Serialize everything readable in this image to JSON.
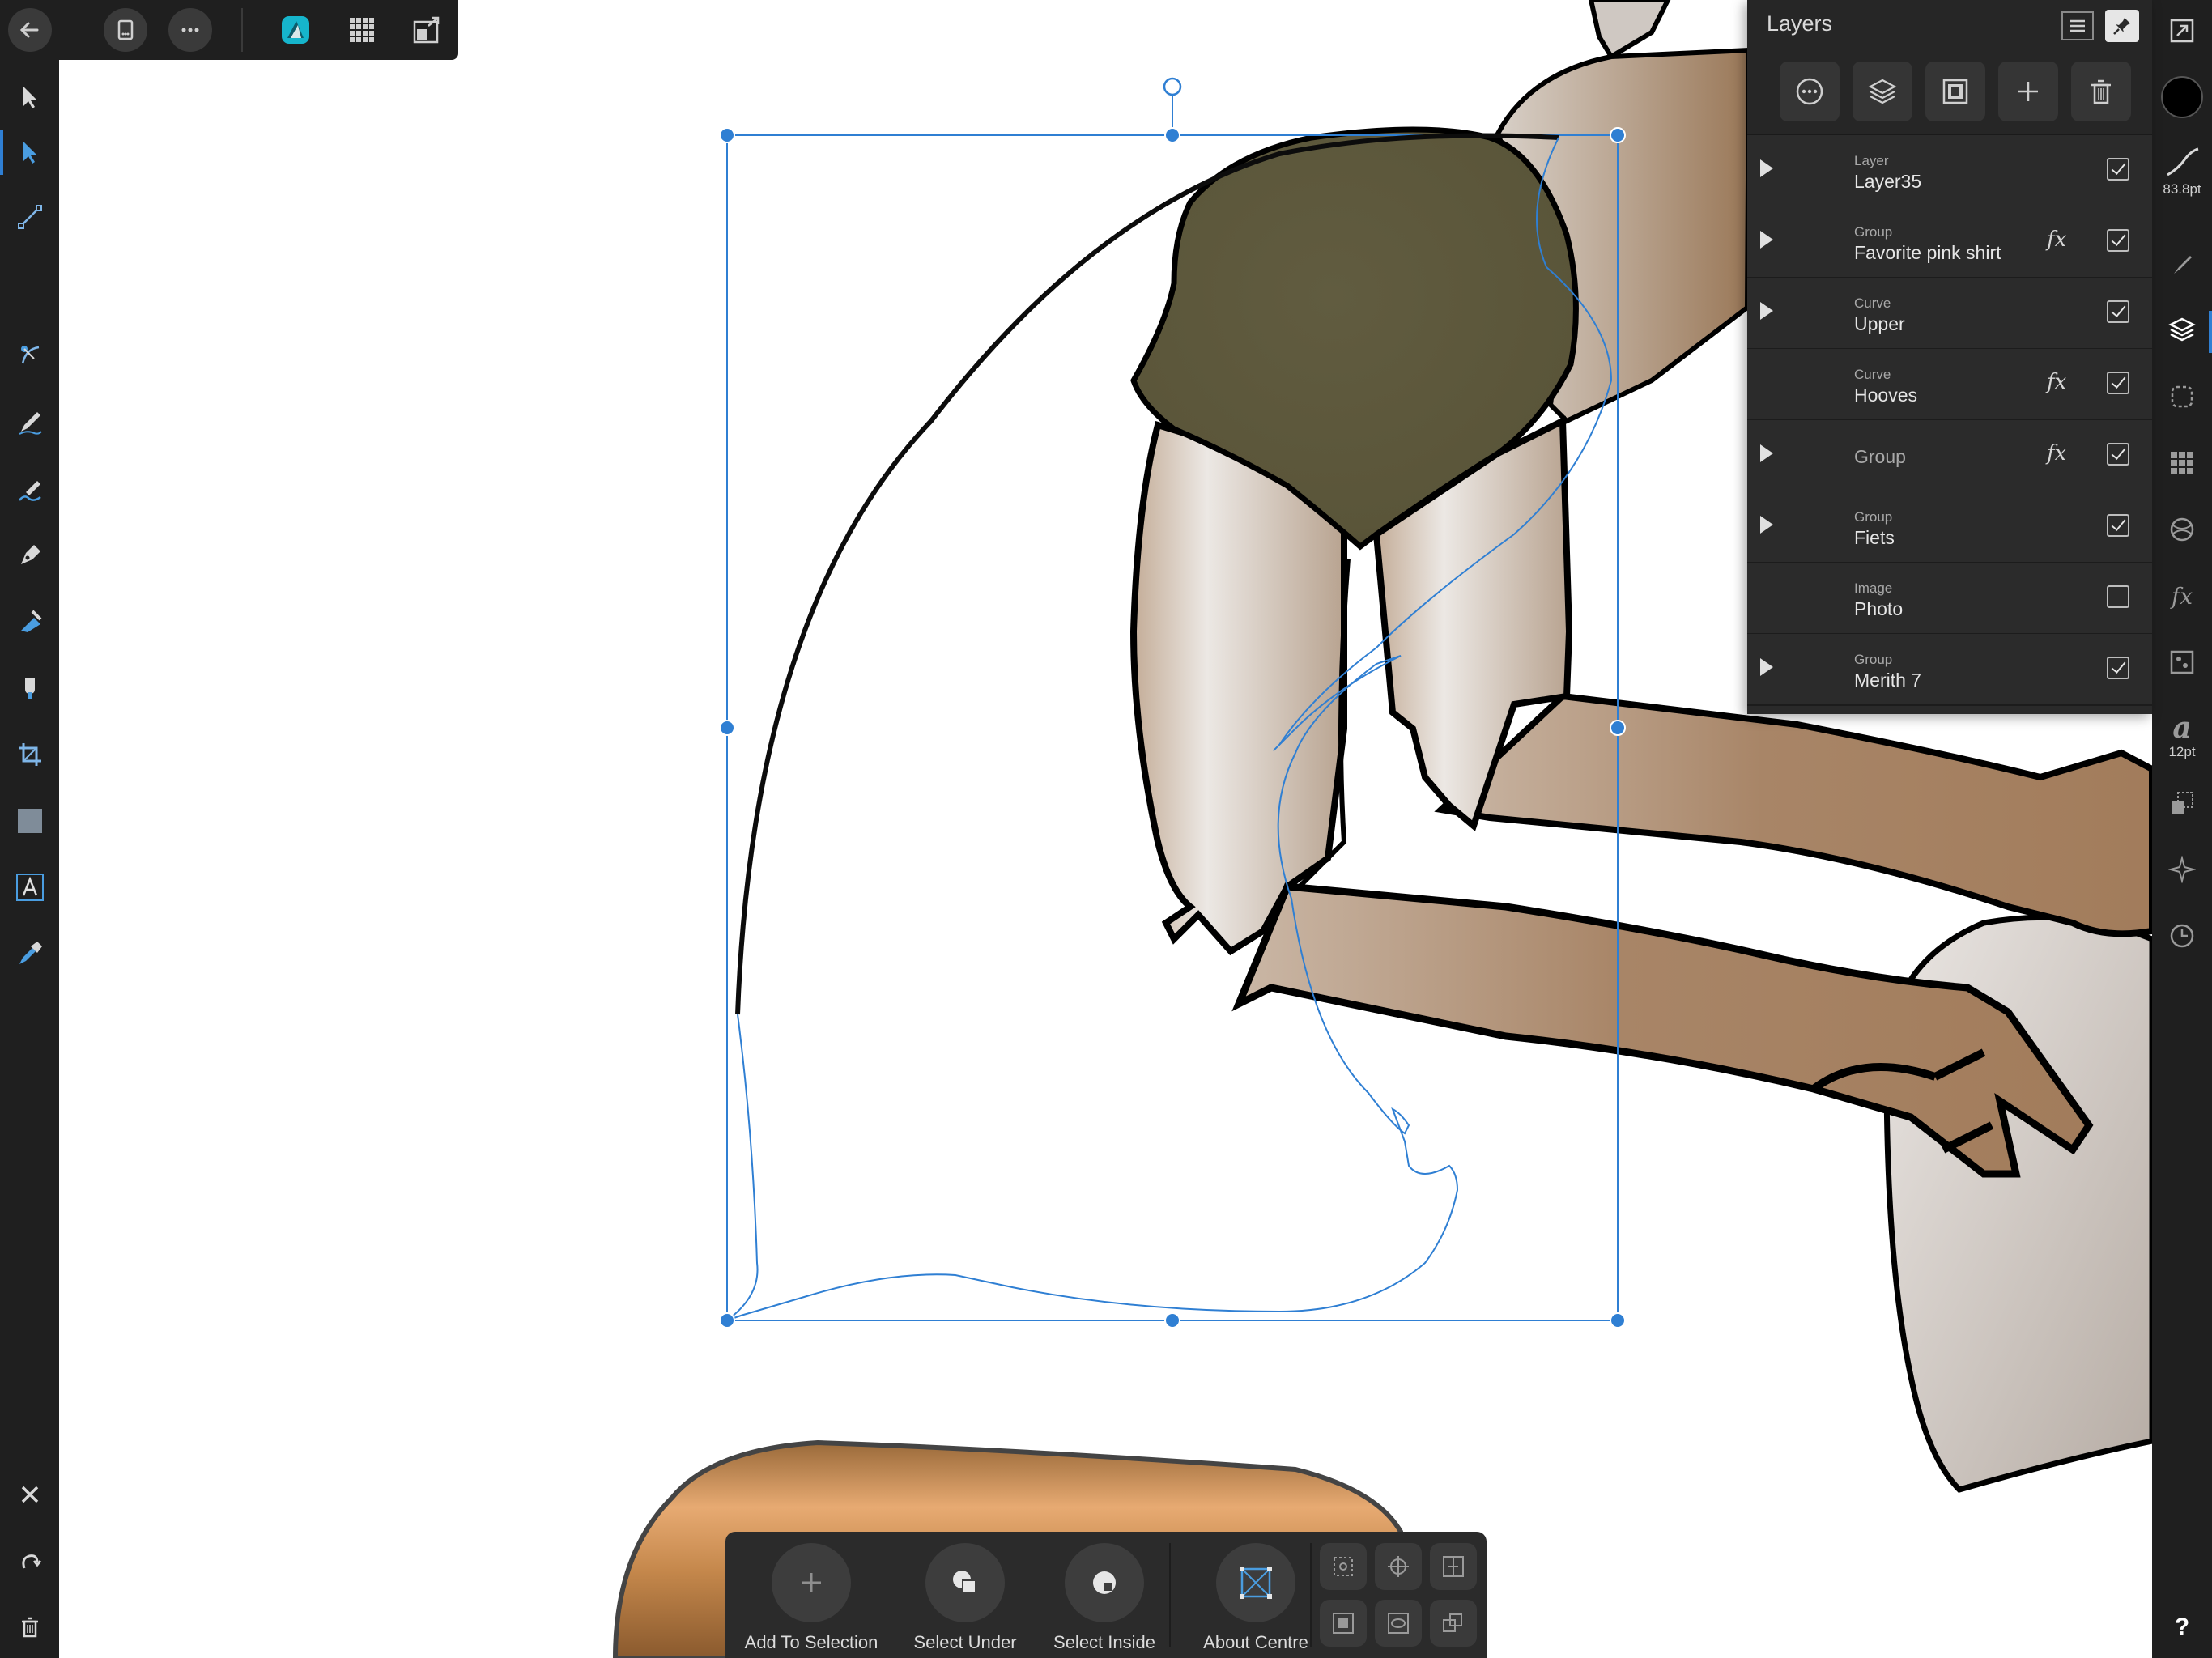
{
  "top_toolbar": {
    "buttons": [
      "back-icon",
      "document-icon",
      "more-icon",
      "designer-persona-icon",
      "pixel-persona-icon",
      "export-persona-icon"
    ]
  },
  "left_tools": [
    "move-tool-icon",
    "node-tool-icon",
    "corner-tool-icon",
    "point-transform-icon",
    "pencil-tool-icon",
    "vector-brush-icon",
    "pen-tool-icon",
    "fill-tool-icon",
    "transparency-tool-icon",
    "crop-tool-icon",
    "rectangle-tool-icon",
    "artistic-text-icon",
    "color-picker-icon"
  ],
  "left_bottom_actions": [
    "close-icon",
    "undo-icon",
    "delete-icon"
  ],
  "right_strip": {
    "stroke_width_label": "83.8pt",
    "text_size_label": "12pt",
    "help_label": "?"
  },
  "layers_panel": {
    "title": "Layers",
    "layers": [
      {
        "type": "Layer",
        "name": "Layer35",
        "expandable": true,
        "fx": false,
        "visible": true
      },
      {
        "type": "Group",
        "name": "Favorite pink shirt",
        "expandable": true,
        "fx": true,
        "visible": true
      },
      {
        "type": "Curve",
        "name": "Upper",
        "expandable": true,
        "fx": false,
        "visible": true
      },
      {
        "type": "Curve",
        "name": "Hooves",
        "expandable": false,
        "fx": true,
        "visible": true
      },
      {
        "type": "",
        "name": "Group",
        "expandable": true,
        "fx": true,
        "visible": true
      },
      {
        "type": "Group",
        "name": "Fiets",
        "expandable": true,
        "fx": false,
        "visible": true
      },
      {
        "type": "Image",
        "name": "Photo",
        "expandable": false,
        "fx": false,
        "visible": false
      },
      {
        "type": "Group",
        "name": "Merith 7",
        "expandable": true,
        "fx": false,
        "visible": true
      }
    ],
    "fx_label": "fx"
  },
  "context_toolbar": {
    "add_to_selection": "Add To Selection",
    "select_under": "Select Under",
    "select_inside": "Select Inside",
    "about_centre": "About Centre"
  },
  "colors": {
    "accent": "#2f7fd3",
    "toolbar_bg": "#1f1f1f",
    "panel_bg": "#2a2a2a",
    "shirt": "#5e5a3e",
    "skin_light": "#e6e1dc",
    "skin_dark": "#a4815f"
  }
}
